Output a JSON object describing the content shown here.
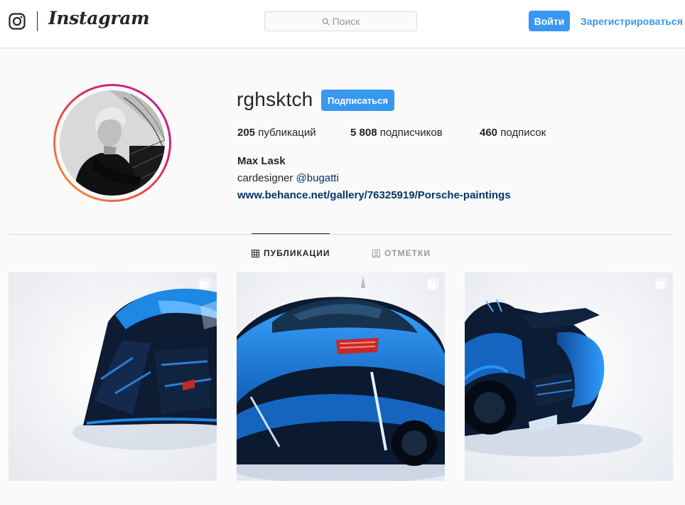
{
  "header": {
    "wordmark": "Instagram",
    "search_placeholder": "Поиск",
    "login_label": "Войти",
    "signup_label": "Зарегистрироваться"
  },
  "profile": {
    "username": "rghsktch",
    "follow_label": "Подписаться",
    "stats": {
      "posts_count": "205",
      "posts_label": " публикаций",
      "followers_count": "5 808",
      "followers_label": " подписчиков",
      "following_count": "460",
      "following_label": " подписок"
    },
    "full_name": "Max Lask",
    "bio_prefix": "cardesigner ",
    "bio_mention": "@bugatti",
    "website": "www.behance.net/gallery/76325919/Porsche-paintings"
  },
  "tabs": [
    {
      "label": "ПУБЛИКАЦИИ",
      "icon": "grid-icon",
      "active": true
    },
    {
      "label": "ОТМЕТКИ",
      "icon": "tagged-icon",
      "active": false
    }
  ],
  "posts": [
    {
      "icon": "carousel-icon"
    },
    {
      "icon": "carousel-icon"
    },
    {
      "icon": "carousel-icon"
    }
  ],
  "colors": {
    "accent": "#3897f0",
    "link": "#003569",
    "car_blue": "#1e88e5",
    "car_dark": "#0d1b33"
  }
}
